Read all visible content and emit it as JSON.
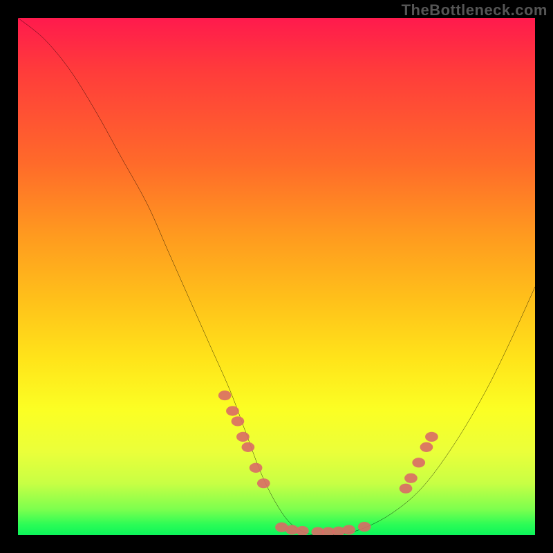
{
  "watermark": "TheBottleneck.com",
  "chart_data": {
    "type": "line",
    "title": "",
    "xlabel": "",
    "ylabel": "",
    "xlim": [
      0,
      100
    ],
    "ylim": [
      0,
      100
    ],
    "grid": false,
    "legend": false,
    "series": [
      {
        "name": "curve",
        "x": [
          0,
          5,
          10,
          15,
          20,
          25,
          29,
          33,
          37,
          41,
          44,
          47,
          50,
          53,
          57,
          61,
          66,
          72,
          78,
          84,
          90,
          95,
          100
        ],
        "y": [
          100,
          96,
          90,
          82,
          73,
          64,
          55,
          46,
          37,
          28,
          20,
          12,
          6,
          2,
          0,
          0,
          1,
          4,
          9,
          17,
          27,
          37,
          48
        ]
      }
    ],
    "markers": [
      {
        "name": "dots-left",
        "color": "#d96b66",
        "points": [
          {
            "x": 40,
            "y": 27
          },
          {
            "x": 41.5,
            "y": 24
          },
          {
            "x": 42.5,
            "y": 22
          },
          {
            "x": 43.5,
            "y": 19
          },
          {
            "x": 44.5,
            "y": 17
          },
          {
            "x": 46,
            "y": 13
          },
          {
            "x": 47.5,
            "y": 10
          }
        ]
      },
      {
        "name": "dots-bottom",
        "color": "#d96b66",
        "points": [
          {
            "x": 51,
            "y": 1.5
          },
          {
            "x": 53,
            "y": 1
          },
          {
            "x": 55,
            "y": 0.8
          },
          {
            "x": 58,
            "y": 0.6
          },
          {
            "x": 60,
            "y": 0.6
          },
          {
            "x": 62,
            "y": 0.7
          },
          {
            "x": 64,
            "y": 1
          },
          {
            "x": 67,
            "y": 1.6
          }
        ]
      },
      {
        "name": "dots-right",
        "color": "#d96b66",
        "points": [
          {
            "x": 75,
            "y": 9
          },
          {
            "x": 76,
            "y": 11
          },
          {
            "x": 77.5,
            "y": 14
          },
          {
            "x": 79,
            "y": 17
          },
          {
            "x": 80,
            "y": 19
          }
        ]
      }
    ],
    "gradient_stops": [
      {
        "pos": 0,
        "color": "#ff1a4d"
      },
      {
        "pos": 28,
        "color": "#ff6a2a"
      },
      {
        "pos": 55,
        "color": "#ffc21a"
      },
      {
        "pos": 76,
        "color": "#fbff24"
      },
      {
        "pos": 95,
        "color": "#7dff4e"
      },
      {
        "pos": 100,
        "color": "#0cf55a"
      }
    ]
  }
}
